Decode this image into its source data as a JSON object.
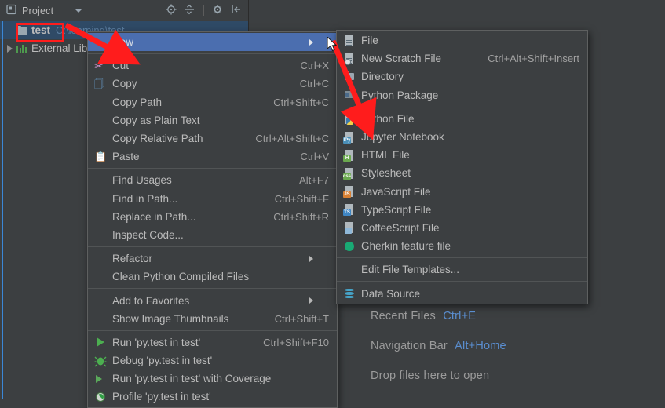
{
  "app": {
    "theme_bg": "#3c3f41",
    "accent_selection": "#4b6eaf",
    "annotation_color": "#ff1c1c"
  },
  "tool_window": {
    "title": "Project",
    "icons": [
      "project-view-icon",
      "chevron-down-icon",
      "locate-icon",
      "collapse-all-icon",
      "settings-gear-icon",
      "hide-icon"
    ]
  },
  "project_tree": {
    "nodes": [
      {
        "label": "test",
        "path": "C:\\learning\\test",
        "icon": "folder-icon",
        "selected": true,
        "expandable": false
      },
      {
        "label": "External Libraries",
        "path": "",
        "icon": "library-icon",
        "selected": false,
        "expandable": true
      }
    ]
  },
  "context_menu": {
    "items": [
      {
        "label": "New",
        "accel": "",
        "icon": "",
        "selected": true,
        "submenu": true,
        "type": "item"
      },
      {
        "type": "separator"
      },
      {
        "label": "Cut",
        "accel": "Ctrl+X",
        "icon": "scissors-icon",
        "type": "item"
      },
      {
        "label": "Copy",
        "accel": "Ctrl+C",
        "icon": "copy-icon",
        "type": "item"
      },
      {
        "label": "Copy Path",
        "accel": "Ctrl+Shift+C",
        "icon": "",
        "type": "item"
      },
      {
        "label": "Copy as Plain Text",
        "accel": "",
        "icon": "",
        "type": "item"
      },
      {
        "label": "Copy Relative Path",
        "accel": "Ctrl+Alt+Shift+C",
        "icon": "",
        "type": "item"
      },
      {
        "label": "Paste",
        "accel": "Ctrl+V",
        "icon": "paste-icon",
        "type": "item"
      },
      {
        "type": "separator"
      },
      {
        "label": "Find Usages",
        "accel": "Alt+F7",
        "icon": "",
        "type": "item"
      },
      {
        "label": "Find in Path...",
        "accel": "Ctrl+Shift+F",
        "icon": "",
        "type": "item"
      },
      {
        "label": "Replace in Path...",
        "accel": "Ctrl+Shift+R",
        "icon": "",
        "type": "item"
      },
      {
        "label": "Inspect Code...",
        "accel": "",
        "icon": "",
        "type": "item"
      },
      {
        "type": "separator"
      },
      {
        "label": "Refactor",
        "accel": "",
        "icon": "",
        "submenu": true,
        "type": "item"
      },
      {
        "label": "Clean Python Compiled Files",
        "accel": "",
        "icon": "",
        "type": "item"
      },
      {
        "type": "separator"
      },
      {
        "label": "Add to Favorites",
        "accel": "",
        "icon": "",
        "submenu": true,
        "type": "item"
      },
      {
        "label": "Show Image Thumbnails",
        "accel": "Ctrl+Shift+T",
        "icon": "",
        "type": "item"
      },
      {
        "type": "separator"
      },
      {
        "label": "Run 'py.test in test'",
        "accel": "Ctrl+Shift+F10",
        "icon": "run-icon",
        "type": "item"
      },
      {
        "label": "Debug 'py.test in test'",
        "accel": "",
        "icon": "debug-icon",
        "type": "item"
      },
      {
        "label": "Run 'py.test in test' with Coverage",
        "accel": "",
        "icon": "coverage-icon",
        "type": "item"
      },
      {
        "label": "Profile 'py.test in test'",
        "accel": "",
        "icon": "profile-icon",
        "type": "item"
      }
    ]
  },
  "new_submenu": {
    "items": [
      {
        "label": "File",
        "accel": "",
        "icon": "file-icon",
        "type": "item"
      },
      {
        "label": "New Scratch File",
        "accel": "Ctrl+Alt+Shift+Insert",
        "icon": "scratch-file-icon",
        "type": "item"
      },
      {
        "label": "Directory",
        "accel": "",
        "icon": "directory-icon",
        "type": "item"
      },
      {
        "label": "Python Package",
        "accel": "",
        "icon": "python-package-icon",
        "type": "item"
      },
      {
        "type": "separator"
      },
      {
        "label": "Python File",
        "accel": "",
        "icon": "python-file-icon",
        "type": "item"
      },
      {
        "label": "Jupyter Notebook",
        "accel": "",
        "icon": "jupyter-notebook-icon",
        "type": "item"
      },
      {
        "label": "HTML File",
        "accel": "",
        "icon": "html-file-icon",
        "type": "item"
      },
      {
        "label": "Stylesheet",
        "accel": "",
        "icon": "css-file-icon",
        "type": "item"
      },
      {
        "label": "JavaScript File",
        "accel": "",
        "icon": "javascript-file-icon",
        "type": "item"
      },
      {
        "label": "TypeScript File",
        "accel": "",
        "icon": "typescript-file-icon",
        "type": "item"
      },
      {
        "label": "CoffeeScript File",
        "accel": "",
        "icon": "coffeescript-file-icon",
        "type": "item"
      },
      {
        "label": "Gherkin feature file",
        "accel": "",
        "icon": "gherkin-icon",
        "type": "item"
      },
      {
        "type": "separator"
      },
      {
        "label": "Edit File Templates...",
        "accel": "",
        "icon": "",
        "type": "item"
      },
      {
        "type": "separator"
      },
      {
        "label": "Data Source",
        "accel": "",
        "icon": "data-source-icon",
        "type": "item"
      }
    ]
  },
  "editor_hints": [
    {
      "text": "Recent Files",
      "key": "Ctrl+E"
    },
    {
      "text": "Navigation Bar",
      "key": "Alt+Home"
    },
    {
      "text": "Drop files here to open",
      "key": ""
    }
  ]
}
